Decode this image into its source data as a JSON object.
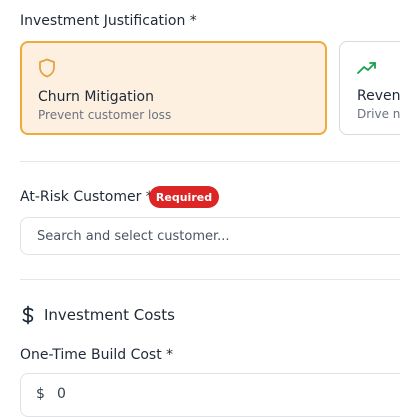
{
  "justification": {
    "label": "Investment Justification *",
    "options": [
      {
        "title": "Churn Mitigation",
        "subtitle": "Prevent customer loss",
        "icon": "shield-icon",
        "selected": true
      },
      {
        "title": "Revenue",
        "subtitle": "Drive new",
        "icon": "trending-up-icon",
        "selected": false
      }
    ]
  },
  "customer": {
    "label": "At-Risk Customer *",
    "badge": "Required",
    "placeholder": "Search and select customer..."
  },
  "costs": {
    "section_title": "Investment Costs",
    "section_icon": "dollar-icon",
    "build_cost_label": "One-Time Build Cost *",
    "currency_symbol": "$",
    "build_cost_value": "0"
  },
  "colors": {
    "selected_border": "#f0aa3a",
    "selected_bg": "#fdf0e1",
    "badge_bg": "#dc2626",
    "trend_green": "#16a34a"
  }
}
